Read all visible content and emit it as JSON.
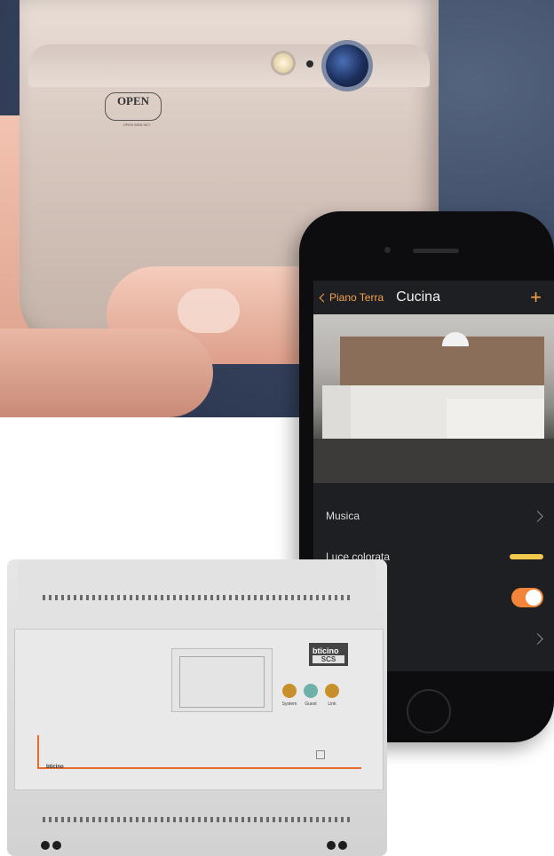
{
  "app": {
    "nav": {
      "back_label": "Piano Terra",
      "title": "Cucina",
      "add_label": "+"
    },
    "rows": [
      {
        "label": "Musica",
        "control": "chevron-right-icon"
      },
      {
        "label": "Luce colorata",
        "control": "color-bar",
        "color": "#f2c94c"
      },
      {
        "label": "",
        "control": "toggle",
        "state": "on",
        "color": "#f4843a"
      },
      {
        "label": "",
        "control": "chevron-right-icon"
      }
    ],
    "accent_color": "#f4a14a"
  },
  "device": {
    "logo_text": "OPEN",
    "logo_subtext": "OPEN WEB NET",
    "brand_top": "bticino",
    "brand_bottom": "SCS",
    "brand_small": "bticino",
    "leds": [
      {
        "label": "System",
        "color": "#c8902a"
      },
      {
        "label": "Guest",
        "color": "#6fb0a8"
      },
      {
        "label": "Link",
        "color": "#c8902a"
      }
    ]
  }
}
